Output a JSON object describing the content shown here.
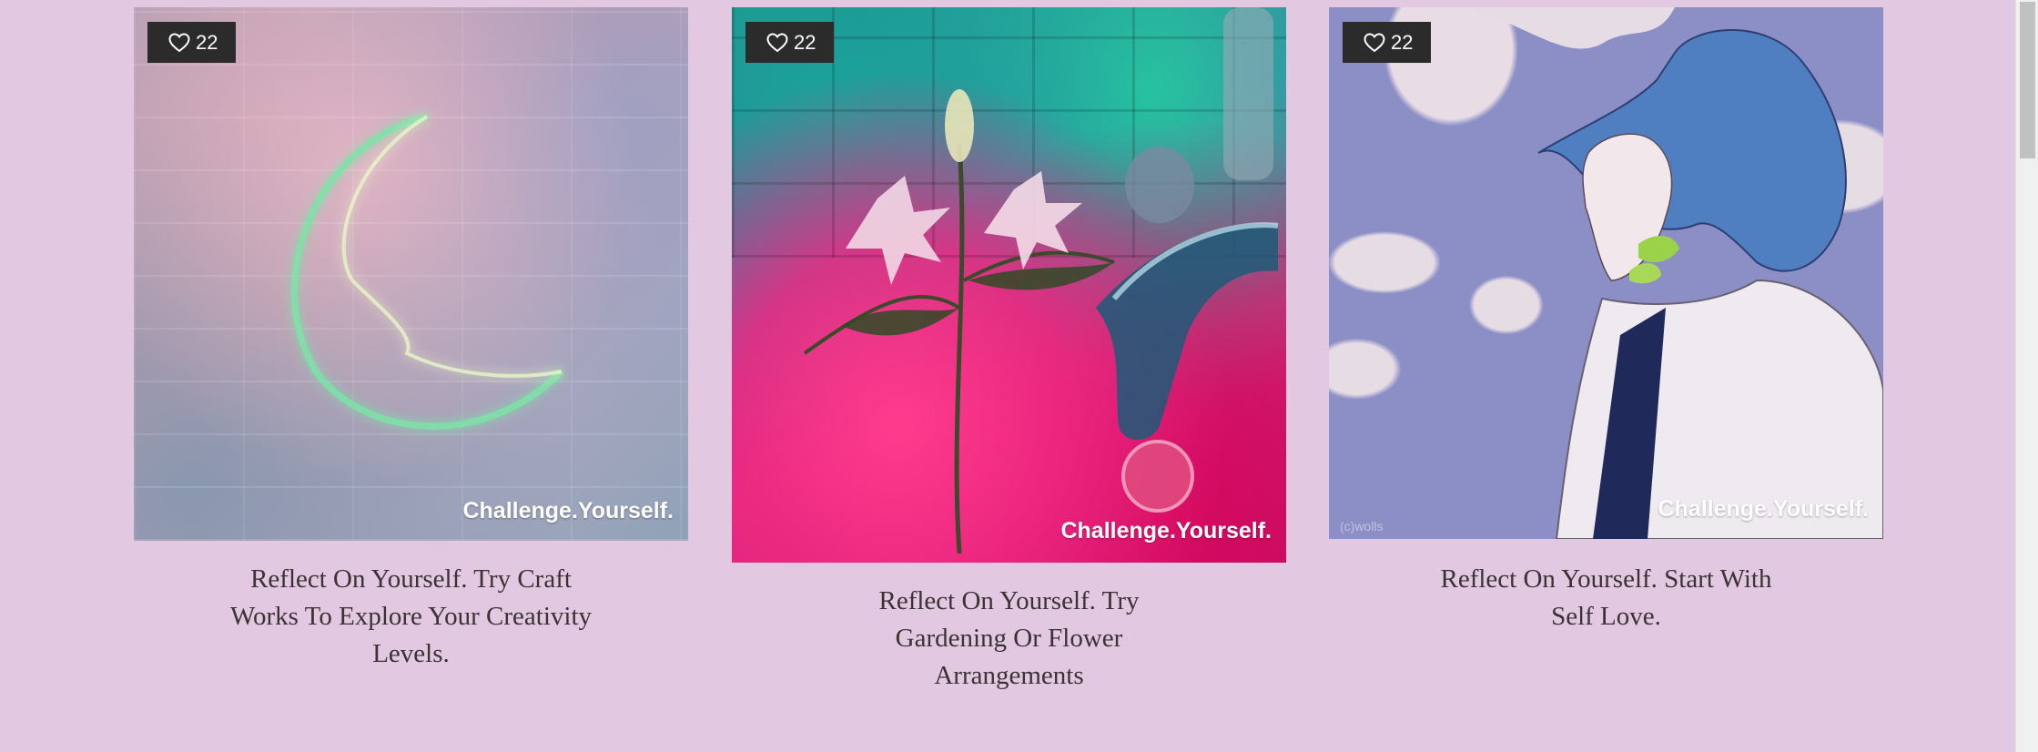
{
  "cards": [
    {
      "likes": "22",
      "watermark": "Challenge.Yourself.",
      "caption": "Reflect On Yourself. Try Craft Works To Explore Your Creativity Levels."
    },
    {
      "likes": "22",
      "watermark": "Challenge.Yourself.",
      "caption": "Reflect On Yourself. Try Gardening Or Flower Arrangements"
    },
    {
      "likes": "22",
      "watermark": "Challenge.Yourself.",
      "credit": "(c)wolls",
      "caption": "Reflect On Yourself. Start With Self Love."
    }
  ],
  "icons": {
    "like": "heart-outline-icon"
  },
  "colors": {
    "background": "#e2c8e0",
    "badge": "#2b2b2b",
    "caption_text": "#3b3236"
  }
}
